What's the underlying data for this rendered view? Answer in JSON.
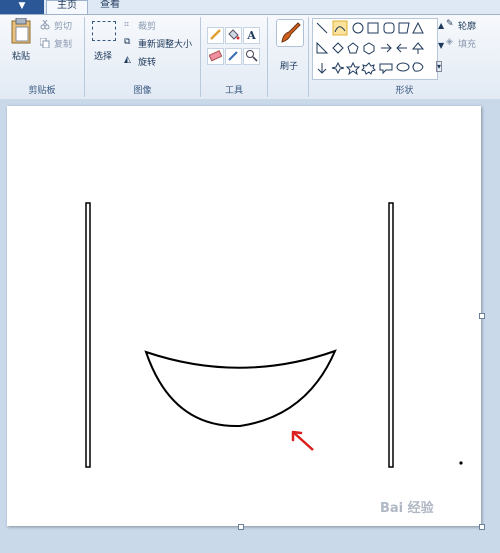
{
  "tabs": {
    "app_button": "▼",
    "home": "主页",
    "view": "查看"
  },
  "clipboard": {
    "paste": "粘贴",
    "cut": "剪切",
    "copy": "复制",
    "group": "剪贴板"
  },
  "image": {
    "select": "选择",
    "crop": "裁剪",
    "resize": "重新调整大小",
    "rotate": "旋转",
    "group": "图像"
  },
  "tools": {
    "group": "工具",
    "text_tool": "A"
  },
  "brushes": {
    "label": "刷子"
  },
  "shapes": {
    "outline": "轮廓",
    "fill": "填充",
    "group": "形状"
  },
  "watermark": "Bai 经验",
  "colors": {
    "ribbon_accent": "#2b5797",
    "arrow": "#d9201f"
  }
}
